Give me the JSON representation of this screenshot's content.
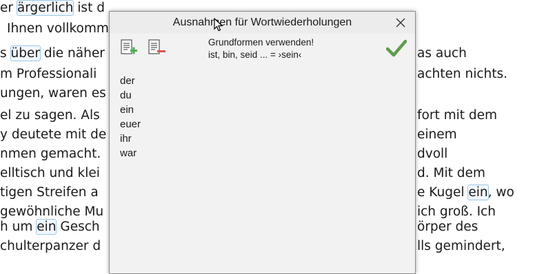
{
  "document": {
    "lines": [
      {
        "before": "er ",
        "highlight": "ärgerlich",
        "after": " ist d"
      },
      {
        "before": "Ihnen vollkomm",
        "highlight": "",
        "after": ""
      },
      {
        "before": "s ",
        "highlight": "über",
        "after": " die näher"
      },
      {
        "before": "m Professionali",
        "highlight": "",
        "after": ""
      },
      {
        "before": "ungen, waren es",
        "highlight": "",
        "after": ""
      },
      {
        "before": "el zu sagen. Als",
        "highlight": "",
        "after": ""
      },
      {
        "before": "y deutete mit de",
        "highlight": "",
        "after": ""
      },
      {
        "before": "nmen gemacht.",
        "highlight": "",
        "after": ""
      },
      {
        "before": "elltisch und klei",
        "highlight": "",
        "after": ""
      },
      {
        "before": "tigen Streifen a",
        "highlight": "",
        "after": ""
      },
      {
        "before": "gewöhnliche Mu",
        "highlight": "",
        "after": ""
      },
      {
        "before": "h um ",
        "highlight": "ein",
        "after": " Gesch"
      },
      {
        "before": "chulterpanzer d",
        "highlight": "",
        "after": ""
      }
    ],
    "right_lines": [
      {
        "text": "as auch",
        "highlight": "",
        "after": ""
      },
      {
        "text": "achten nichts.",
        "highlight": "",
        "after": ""
      },
      {
        "text": "fort mit dem",
        "highlight": "",
        "after": ""
      },
      {
        "text": "einem",
        "highlight": "",
        "after": ""
      },
      {
        "text": "dvoll",
        "highlight": "",
        "after": ""
      },
      {
        "text": "d. Mit dem",
        "highlight": "",
        "after": ""
      },
      {
        "text": "e Kugel ",
        "highlight": "ein",
        "after": ", wo"
      },
      {
        "text": "ich groß. Ich",
        "highlight": "",
        "after": ""
      },
      {
        "text": "örper des",
        "highlight": "",
        "after": ""
      },
      {
        "text": "lls gemindert,",
        "highlight": "",
        "after": ""
      }
    ]
  },
  "dialog": {
    "title": "Ausnahmen für Wortwiederholungen",
    "base_forms_line1": "Grundformen verwenden!",
    "base_forms_line2": "ist, bin, seid ... = ›sein‹",
    "words": [
      "der",
      "du",
      "ein",
      "euer",
      "ihr",
      "war"
    ],
    "icons": {
      "add": "add-list-icon",
      "remove": "remove-list-icon",
      "confirm": "checkmark-icon",
      "close": "close-icon"
    },
    "colors": {
      "add_accent": "#4caf50",
      "remove_accent": "#d9534f",
      "check": "#5f9b4e"
    }
  }
}
